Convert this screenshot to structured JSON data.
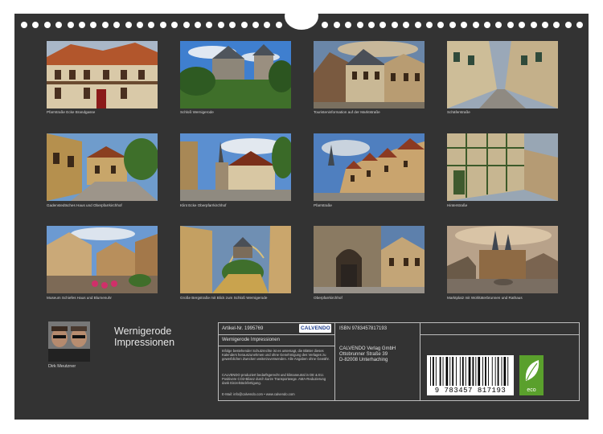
{
  "captions": [
    "Pfarrstraße Ecke Brandgasse",
    "Schloß Wernigerode",
    "Touristeninformation auf der Marktstraße",
    "Schäferstraße",
    "Gadenstedtsches Haus und Oberpfarrkirchhof",
    "Klint Ecke Oberpfarrkirchhof",
    "Pfarrstraße",
    "Hinterstraße",
    "Museum Schiefes Haus und Blumenuhr",
    "Große Bergstraße mit Blick zum Schloß Wernigerode",
    "Oberpfarrkirchhof",
    "Marktplatz mit Wohltäterbrunnen und Rathaus"
  ],
  "calendar_title": [
    "Wernigerode",
    "Impressionen"
  ],
  "author": "Dirk Meutzner",
  "info": {
    "article_no": "Artikel-Nr. 1995769",
    "brand_logo": "CALVENDO",
    "product_title": "Wernigerode Impressionen",
    "isbn": "ISBN 9783457817193",
    "publisher": [
      "CALVENDO Verlag GmbH",
      "Ottobrunner Straße 39",
      "D-82008 Unterhaching"
    ],
    "legal": "Infolge bestehender Schutzrechte ist es untersagt, die Blätter dieses Kalenders herauszunehmen und ohne Genehmigung des Verlages zu gewerblichen Zwecken weiterzuverwenden. Alle Angaben ohne Gewähr.",
    "production": "CALVENDO produziert bedarfsgerecht und klimaneutral in DE & EU. Positivere CO2-Bilanz durch kurze Transportwege. AMA-Reduzierung dank Einzelstückfertigung.",
    "contact": "E-Mail: info@calvendo.com • www.calvendo.com",
    "barcode_number": "9 783457 817193",
    "eco_label": "eco"
  }
}
